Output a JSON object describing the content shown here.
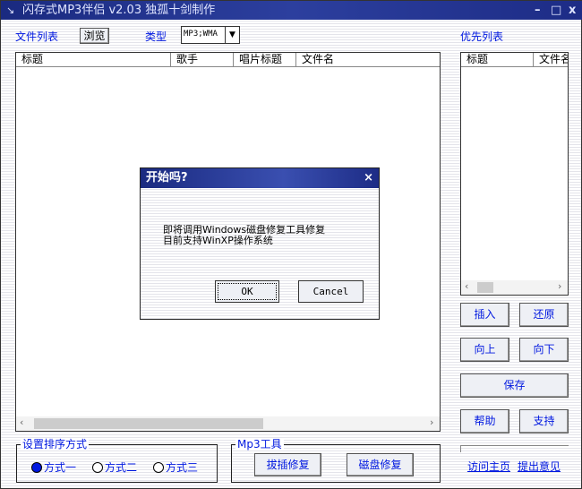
{
  "window": {
    "title": "闪存式MP3伴侣 v2.03 独孤十剑制作",
    "minimize": "–",
    "maximize": "□",
    "close": "x"
  },
  "toolbar": {
    "file_list_label": "文件列表",
    "browse": "浏览",
    "type_label": "类型",
    "type_value": "MP3;WMA",
    "priority_label": "优先列表"
  },
  "file_list": {
    "columns": [
      "标题",
      "歌手",
      "唱片标题",
      "文件名"
    ]
  },
  "priority_list": {
    "columns": [
      "标题",
      "文件名"
    ]
  },
  "buttons": {
    "insert": "插入",
    "restore": "还原",
    "up": "向上",
    "down": "向下",
    "save": "保存",
    "help": "帮助",
    "support": "支持"
  },
  "sort": {
    "legend": "设置排序方式",
    "options": [
      "方式一",
      "方式二",
      "方式三"
    ],
    "selected": 0
  },
  "mp3tools": {
    "legend": "Mp3工具",
    "hotplug_fix": "拔插修复",
    "disk_fix": "磁盘修复"
  },
  "links": {
    "homepage": "访问主页",
    "feedback": "提出意见"
  },
  "dialog": {
    "title": "开始吗?",
    "close": "×",
    "line1": "即将调用Windows磁盘修复工具修复",
    "line2": "目前支持WinXP操作系统",
    "ok": "OK",
    "cancel": "Cancel"
  }
}
